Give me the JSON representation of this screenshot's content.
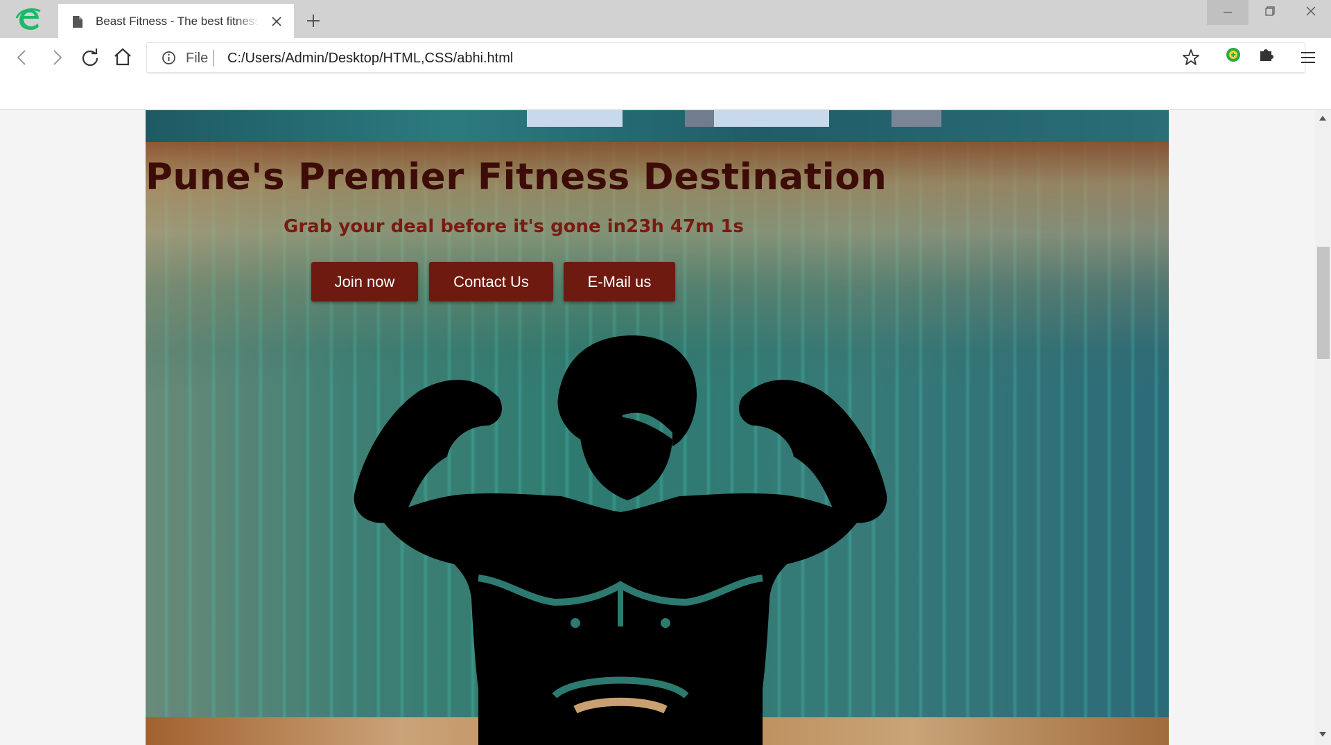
{
  "browser": {
    "tab_title": "Beast Fitness - The best fitness",
    "address_scheme": "File",
    "address_url": "C:/Users/Admin/Desktop/HTML,CSS/abhi.html",
    "icons": [
      "browser-logo-icon",
      "document-icon",
      "close-icon",
      "plus-icon",
      "minimize-icon",
      "restore-icon",
      "window-close-icon",
      "back-icon",
      "forward-icon",
      "reload-icon",
      "home-icon",
      "info-icon",
      "bookmark-star-icon",
      "extension-icon",
      "puzzle-icon",
      "menu-icon"
    ]
  },
  "hero": {
    "title": "Pune's Premier Fitness Destination",
    "subtitle": "Grab your deal before it's gone in23h 47m 1s",
    "buttons": {
      "join": "Join now",
      "contact": "Contact Us",
      "email": "E-Mail us"
    },
    "image_icon": "flexing-muscle-man-icon"
  },
  "colors": {
    "title": "#3d0c08",
    "subtitle": "#7a1a10",
    "button_bg": "#6e1a10",
    "button_text": "#ffffff",
    "logo_green": "#1db86a"
  }
}
